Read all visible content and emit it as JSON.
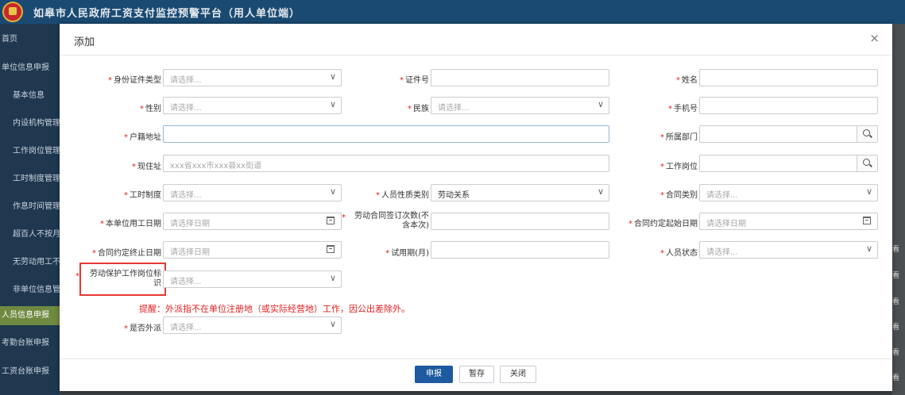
{
  "app": {
    "title": "如皋市人民政府工资支付监控预警平台（用人单位端）"
  },
  "sidebar": {
    "items": [
      {
        "label": "首页"
      },
      {
        "label": "单位信息申报"
      },
      {
        "label": "基本信息"
      },
      {
        "label": "内设机构管理"
      },
      {
        "label": "工作岗位管理"
      },
      {
        "label": "工时制度管理"
      },
      {
        "label": "作息时间管理"
      },
      {
        "label": "超百人不按月"
      },
      {
        "label": "无劳动用工不"
      },
      {
        "label": "非单位信息管"
      },
      {
        "label": "人员信息申报"
      },
      {
        "label": "考勤台账申报"
      },
      {
        "label": "工资台账申报"
      }
    ]
  },
  "background": {
    "right_snippets": [
      "看",
      "看",
      "看",
      "看",
      "看",
      "看"
    ]
  },
  "modal": {
    "title": "添加",
    "close": "×",
    "fields": {
      "id_type": {
        "label": "身份证件类型",
        "placeholder": "请选择..."
      },
      "id_no": {
        "label": "证件号"
      },
      "name": {
        "label": "姓名"
      },
      "gender": {
        "label": "性别",
        "placeholder": "请选择..."
      },
      "ethnicity": {
        "label": "民族",
        "placeholder": "请选择..."
      },
      "phone": {
        "label": "手机号"
      },
      "hukou_addr": {
        "label": "户籍地址"
      },
      "dept": {
        "label": "所属部门"
      },
      "current_addr": {
        "label": "现住址",
        "placeholder": "xxx省xxx市xxx县xx街道"
      },
      "job_post": {
        "label": "工作岗位"
      },
      "work_hours": {
        "label": "工时制度",
        "placeholder": "请选择..."
      },
      "person_type": {
        "label": "人员性质类别",
        "value": "劳动关系"
      },
      "contract_type": {
        "label": "合同类别",
        "placeholder": "请选择..."
      },
      "hire_date": {
        "label": "本单位用工日期",
        "placeholder": "请选择日期"
      },
      "contract_times": {
        "label": "劳动合同签订次数(不含本次)"
      },
      "contract_start": {
        "label": "合同约定起始日期",
        "placeholder": "请选择日期"
      },
      "contract_end": {
        "label": "合同约定终止日期",
        "placeholder": "请选择日期"
      },
      "probation": {
        "label": "试用期(月)"
      },
      "person_status": {
        "label": "人员状态",
        "placeholder": "请选择..."
      },
      "labor_protect": {
        "label": "劳动保护工作岗位标识",
        "placeholder": "请选择..."
      },
      "dispatched": {
        "label": "是否外派",
        "placeholder": "请选择..."
      }
    },
    "reminder": "提醒：外派指不在单位注册地（或实际经营地）工作，因公出差除外。",
    "buttons": {
      "submit": "申报",
      "save": "暂存",
      "close": "关闭"
    }
  },
  "colors": {
    "primary": "#1d5aa0",
    "required": "#e02020",
    "header": "#1a4a72",
    "sidebar_active": "#6f8a40"
  }
}
